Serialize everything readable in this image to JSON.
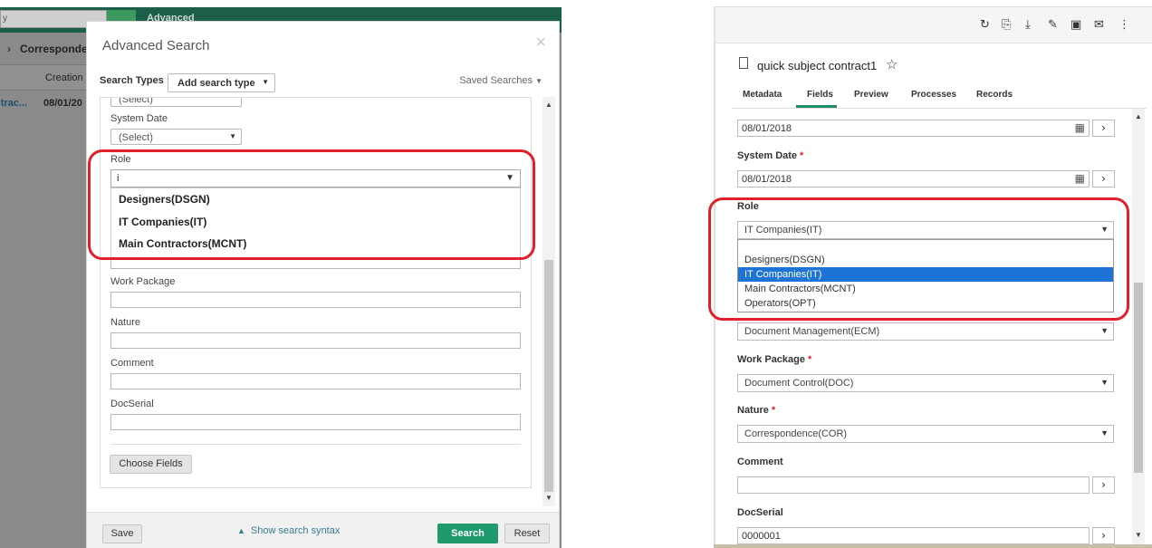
{
  "background_app": {
    "search_placeholder": "y",
    "app_name": "Advanced",
    "breadcrumb_chevron": "›",
    "breadcrumb": "Correspondence",
    "column_header": "Creation",
    "row_ref": "ntrac...",
    "row_date": "08/01/20"
  },
  "dialog": {
    "title": "Advanced Search",
    "close_glyph": "×",
    "search_types_label": "Search Types",
    "add_search_type": "Add search type",
    "saved_searches": "Saved Searches",
    "fields": {
      "prev_select_value": "(Select)",
      "system_date_label": "System Date",
      "system_date_value": "(Select)",
      "role_label": "Role",
      "role_typed": "i",
      "role_options": [
        "Designers(DSGN)",
        "IT Companies(IT)",
        "Main Contractors(MCNT)"
      ],
      "work_package_label": "Work Package",
      "nature_label": "Nature",
      "comment_label": "Comment",
      "docserial_label": "DocSerial"
    },
    "choose_fields": "Choose Fields",
    "footer": {
      "save": "Save",
      "show_syntax": "Show search syntax",
      "search": "Search",
      "reset": "Reset"
    }
  },
  "right_panel": {
    "toolbar_icons": [
      "refresh-icon",
      "add-file-icon",
      "download-icon",
      "sign-icon",
      "text-icon",
      "email-icon",
      "more-icon"
    ],
    "doc_title": "quick subject contract1",
    "tabs": [
      "Metadata",
      "Fields",
      "Preview",
      "Processes",
      "Records"
    ],
    "active_tab": "Fields",
    "fields": {
      "first_date": "08/01/2018",
      "system_date_label": "System Date",
      "system_date_value": "08/01/2018",
      "role_label": "Role",
      "role_value": "IT Companies(IT)",
      "role_options": [
        "",
        "Designers(DSGN)",
        "IT Companies(IT)",
        "Main Contractors(MCNT)",
        "Operators(OPT)"
      ],
      "role_selected_index": 2,
      "department_value": "Document Management(ECM)",
      "work_package_label": "Work Package",
      "work_package_value": "Document Control(DOC)",
      "nature_label": "Nature",
      "nature_value": "Correspondence(COR)",
      "comment_label": "Comment",
      "comment_value": "",
      "docserial_label": "DocSerial",
      "docserial_value": "0000001",
      "required_mark": "*"
    }
  },
  "colors": {
    "highlight_box": "#e0202a",
    "search_button": "#1f9a6c",
    "selected_option": "#1e74d6",
    "active_tab_underline": "#1f8a6a"
  }
}
